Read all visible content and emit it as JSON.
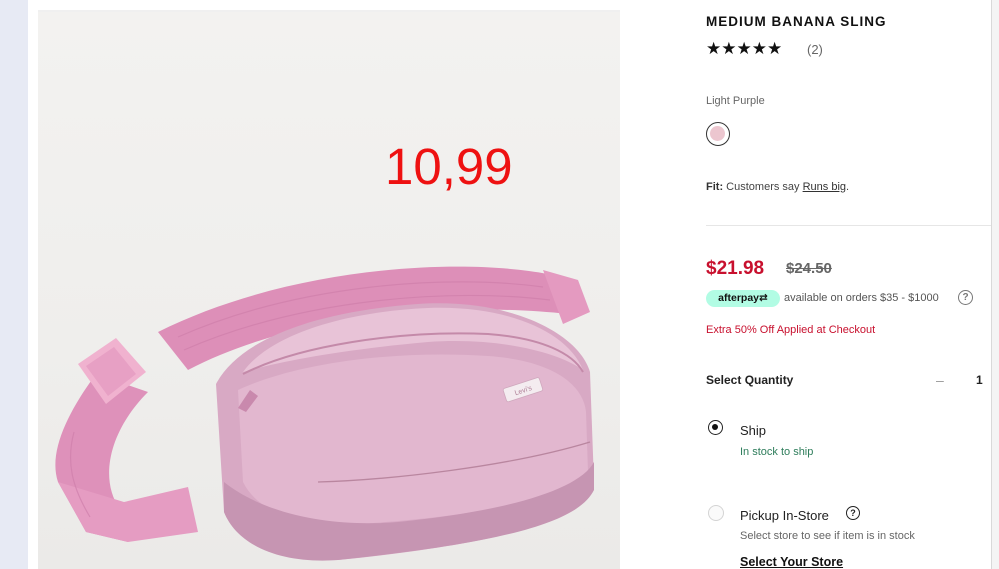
{
  "product": {
    "title": "MEDIUM BANANA SLING",
    "stars": "★★★★★",
    "review_count": "(2)",
    "color_name": "Light Purple",
    "fit_label": "Fit:",
    "fit_text": "Customers say",
    "fit_link": "Runs big",
    "fit_end": ".",
    "overlay_price": "10,99",
    "bag_logo_text": "Levi's"
  },
  "pricing": {
    "sale_price": "$21.98",
    "original_price": "$24.50",
    "afterpay_badge": "afterpay⇄",
    "afterpay_text": "available on orders $35 - $1000",
    "help_glyph": "?",
    "promo_text": "Extra 50% Off Applied at Checkout"
  },
  "quantity": {
    "label": "Select Quantity",
    "minus": "–",
    "value": "1"
  },
  "fulfillment": {
    "ship_label": "Ship",
    "ship_status": "In stock to ship",
    "pickup_label": "Pickup In-Store",
    "pickup_help": "?",
    "pickup_note": "Select store to see if item is in stock",
    "select_store": "Select Your Store"
  },
  "colors": {
    "sale_red": "#c8102e",
    "stock_green": "#2e7d5b",
    "afterpay_mint": "#b2fce4",
    "swatch_pink": "#ecc6cf",
    "overlay_red": "#ee1111"
  }
}
